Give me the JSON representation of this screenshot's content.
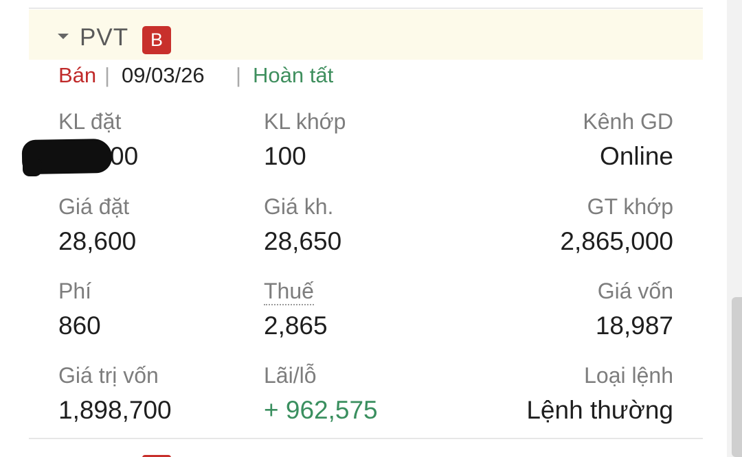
{
  "order": {
    "symbol": "PVT",
    "side_badge": "B",
    "side": "Bán",
    "separator": "|",
    "date": "09/03/26",
    "status": "Hoàn tất"
  },
  "fields": {
    "kl_dat": {
      "label": "KL đặt",
      "value": "00"
    },
    "kl_khop": {
      "label": "KL khớp",
      "value": "100"
    },
    "kenh_gd": {
      "label": "Kênh GD",
      "value": "Online"
    },
    "gia_dat": {
      "label": "Giá đặt",
      "value": "28,600"
    },
    "gia_kh": {
      "label": "Giá kh.",
      "value": "28,650"
    },
    "gt_khop": {
      "label": "GT khớp",
      "value": "2,865,000"
    },
    "phi": {
      "label": "Phí",
      "value": "860"
    },
    "thue": {
      "label": "Thuế",
      "value": "2,865"
    },
    "gia_von": {
      "label": "Giá vốn",
      "value": "18,987"
    },
    "gia_tri_von": {
      "label": "Giá trị vốn",
      "value": "1,898,700"
    },
    "lai_lo": {
      "label": "Lãi/lỗ",
      "value": "+ 962,575"
    },
    "loai_lenh": {
      "label": "Loại lệnh",
      "value": "Lệnh thường"
    }
  },
  "colors": {
    "sell": "#c02a2a",
    "badge": "#c8302c",
    "complete": "#3f8f5e",
    "profit": "#3a8f5f",
    "header_bg": "#fdfaea"
  },
  "icons": {
    "expand": "caret-down-icon"
  }
}
